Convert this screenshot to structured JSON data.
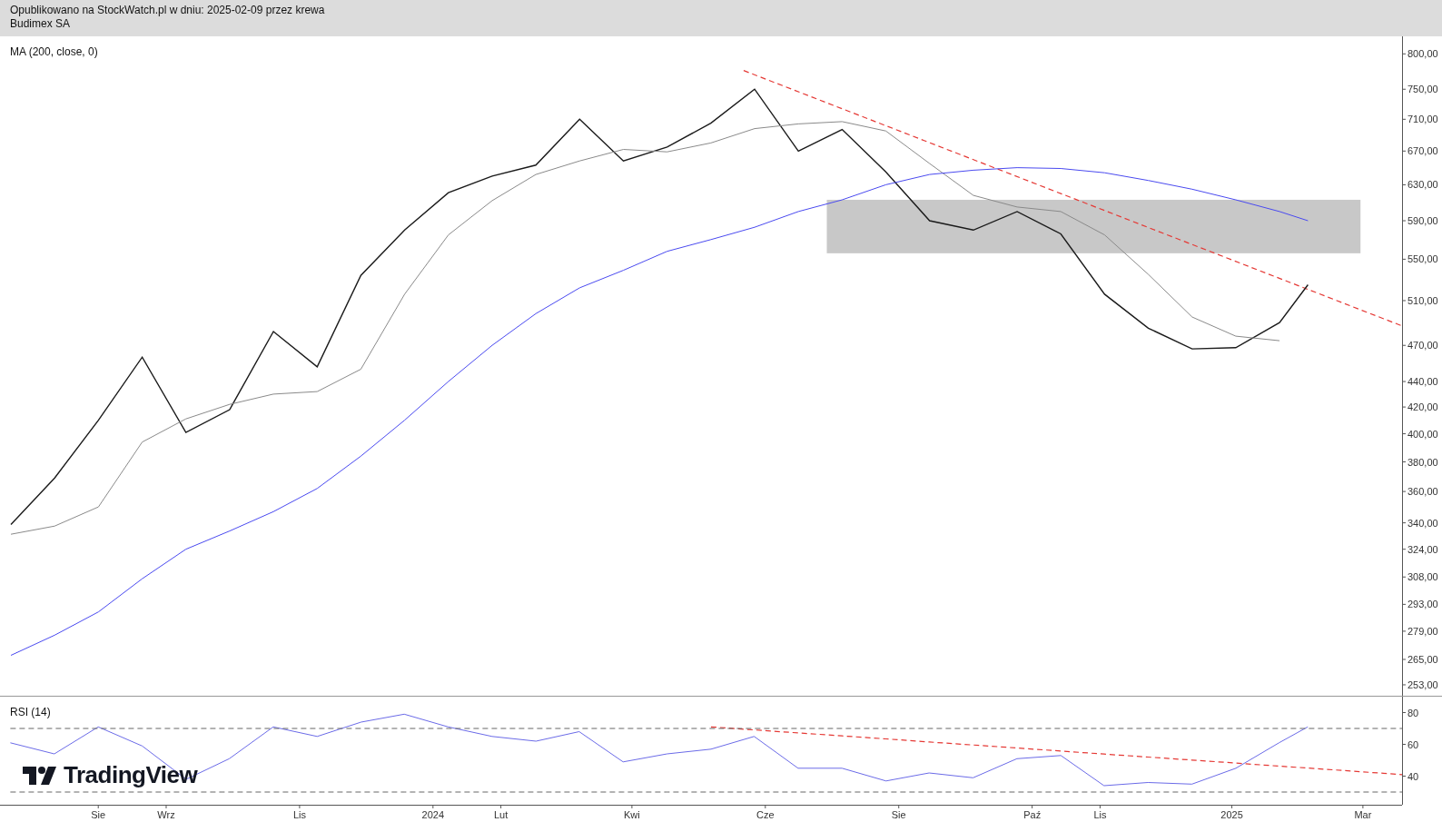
{
  "header": {
    "lines": [
      "Opublikowano na StockWatch.pl w dniu: 2025-02-09 przez krewa",
      "Budimex SA"
    ]
  },
  "price_pane": {
    "legend": "MA (200, close, 0)",
    "y_axis_labels": [
      "800,00",
      "750,00",
      "710,00",
      "670,00",
      "630,00",
      "590,00",
      "550,00",
      "510,00",
      "470,00",
      "440,00",
      "420,00",
      "400,00",
      "380,00",
      "360,00",
      "340,00",
      "324,00",
      "308,00",
      "293,00",
      "279,00",
      "265,00",
      "253,00"
    ]
  },
  "rsi_pane": {
    "legend": "RSI (14)",
    "chart_data": {
      "type": "line",
      "x": [
        2023.471,
        2023.526,
        2023.581,
        2023.636,
        2023.691,
        2023.745,
        2023.8,
        2023.855,
        2023.91,
        2023.964,
        2024.019,
        2024.074,
        2024.129,
        2024.183,
        2024.238,
        2024.293,
        2024.348,
        2024.402,
        2024.457,
        2024.512,
        2024.567,
        2024.621,
        2024.676,
        2024.731,
        2024.786,
        2024.84,
        2024.895,
        2024.95,
        2025.005,
        2025.059,
        2025.095,
        2025.213
      ],
      "xlim": [
        2023.458,
        2025.213
      ],
      "ylim": [
        22,
        90
      ],
      "series": [
        {
          "color": "#6b6be8",
          "values": [
            61,
            54,
            71,
            59,
            38,
            51,
            71,
            65,
            74,
            79,
            71,
            65,
            62,
            68,
            49,
            54,
            57,
            65,
            45,
            45,
            37,
            42,
            39,
            51,
            53,
            34,
            36,
            35,
            45,
            61,
            71,
            null
          ]
        },
        {
          "color": "#e53935",
          "line_style": "dashed",
          "values": [
            null,
            null,
            null,
            null,
            null,
            null,
            null,
            null,
            null,
            null,
            null,
            null,
            null,
            null,
            null,
            null,
            71,
            69.1,
            67.2,
            65.3,
            63.4,
            61.5,
            59.6,
            57.7,
            55.8,
            53.9,
            52,
            50.1,
            48.2,
            46.3,
            45.1,
            41
          ]
        },
        {
          "color": "#666666",
          "line_style": "dashed",
          "values": [
            70,
            70,
            70,
            70,
            70,
            70,
            70,
            70,
            70,
            70,
            70,
            70,
            70,
            70,
            70,
            70,
            70,
            70,
            70,
            70,
            70,
            70,
            70,
            70,
            70,
            70,
            70,
            70,
            70,
            70,
            70,
            70
          ]
        },
        {
          "color": "#666666",
          "line_style": "dashed",
          "values": [
            30,
            30,
            30,
            30,
            30,
            30,
            30,
            30,
            30,
            30,
            30,
            30,
            30,
            30,
            30,
            30,
            30,
            30,
            30,
            30,
            30,
            30,
            30,
            30,
            30,
            30,
            30,
            30,
            30,
            30,
            30,
            30
          ]
        }
      ],
      "yticks": [
        80,
        60,
        40
      ],
      "xticks": [
        {
          "value": 2023.581,
          "label": "Sie"
        },
        {
          "value": 2023.666,
          "label": "Wrz"
        },
        {
          "value": 2023.833,
          "label": "Lis"
        },
        {
          "value": 2024,
          "label": "2024"
        },
        {
          "value": 2024.085,
          "label": "Lut"
        },
        {
          "value": 2024.249,
          "label": "Kwi"
        },
        {
          "value": 2024.416,
          "label": "Cze"
        },
        {
          "value": 2024.583,
          "label": "Sie"
        },
        {
          "value": 2024.75,
          "label": "Paź"
        },
        {
          "value": 2024.835,
          "label": "Lis"
        },
        {
          "value": 2025,
          "label": "2025"
        },
        {
          "value": 2025.164,
          "label": "Mar"
        }
      ]
    }
  },
  "logo": {
    "text": "TradingView"
  }
}
